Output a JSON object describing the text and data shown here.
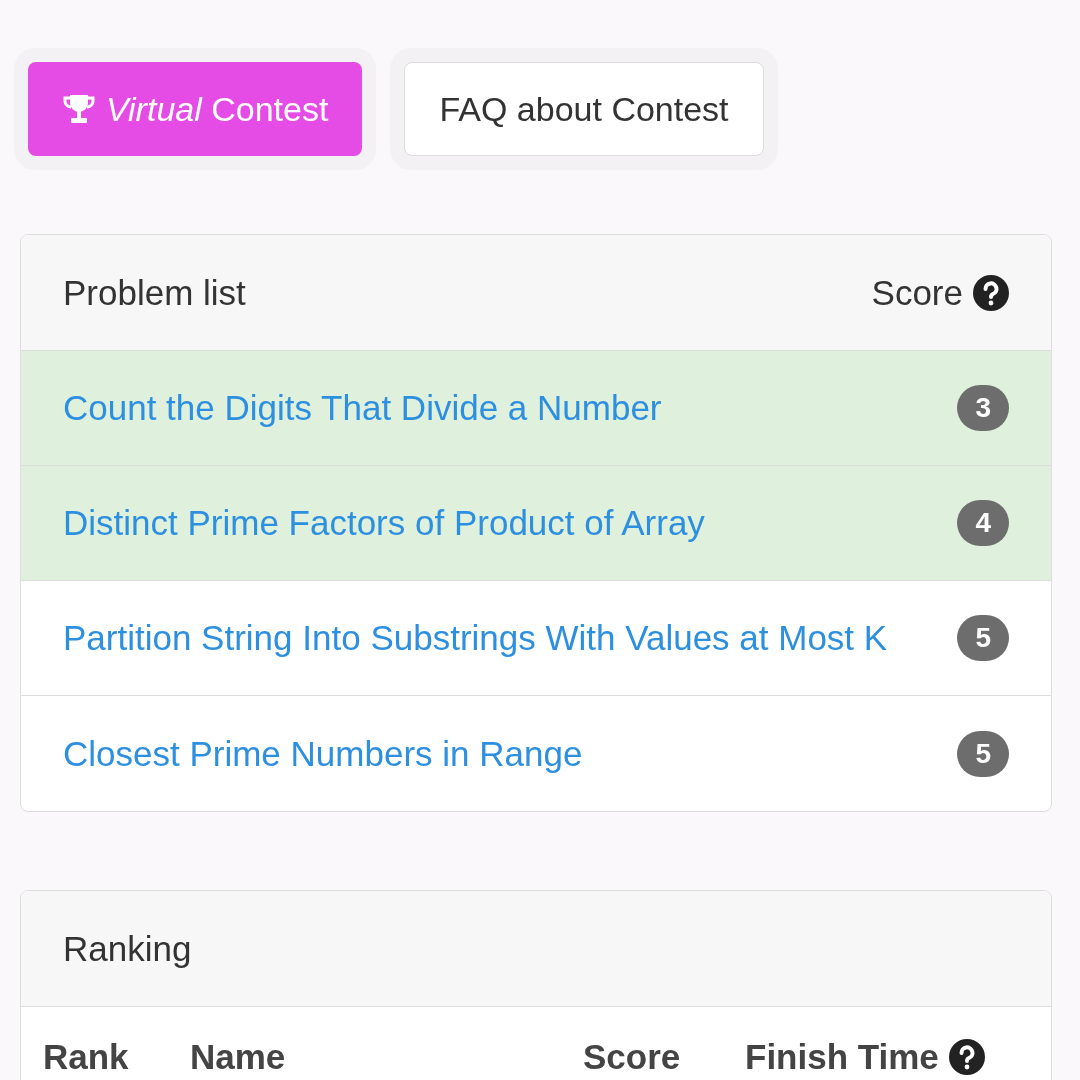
{
  "buttons": [
    {
      "kind": "primary",
      "label": "*Virtual* Contest"
    },
    {
      "kind": "secondary",
      "label": "FAQ about Contest"
    }
  ],
  "problems": {
    "title": "Problem list",
    "score_heading": "Score",
    "rows": [
      {
        "title": "Count the Digits That Divide a Number",
        "score": "3",
        "solved": true
      },
      {
        "title": "Distinct Prime Factors of Product of Array",
        "score": "4",
        "solved": true
      },
      {
        "title": "Partition String Into Substrings With Values at Most K",
        "score": "5",
        "solved": false
      },
      {
        "title": "Closest Prime Numbers in Range",
        "score": "5",
        "solved": false
      }
    ]
  },
  "ranking": {
    "title": "Ranking",
    "columns": [
      "Rank",
      "Name",
      "Score",
      "Finish Time"
    ]
  }
}
